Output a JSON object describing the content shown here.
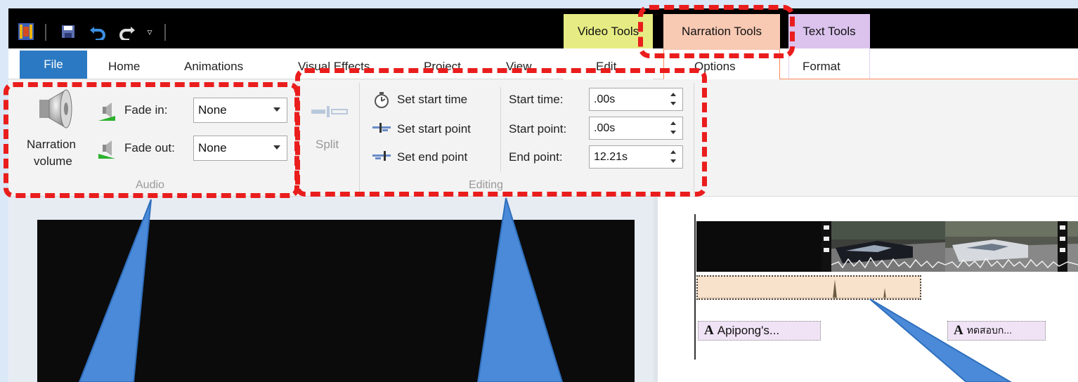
{
  "contextual_tabs": {
    "video_tools": "Video Tools",
    "narration_tools": "Narration Tools",
    "text_tools": "Text Tools"
  },
  "tabs": {
    "file": "File",
    "home": "Home",
    "animations": "Animations",
    "visual_effects": "Visual Effects",
    "project": "Project",
    "view": "View",
    "edit": "Edit",
    "options": "Options",
    "format": "Format"
  },
  "audio_group": {
    "label": "Audio",
    "narration_volume_line1": "Narration",
    "narration_volume_line2": "volume",
    "fade_in_label": "Fade in:",
    "fade_in_value": "None",
    "fade_out_label": "Fade out:",
    "fade_out_value": "None"
  },
  "split_group": {
    "label": "Split"
  },
  "editing_group": {
    "label": "Editing",
    "set_start_time": "Set start time",
    "set_start_point": "Set start point",
    "set_end_point": "Set end point",
    "start_time_label": "Start time:",
    "start_time_value": ".00s",
    "start_point_label": "Start point:",
    "start_point_value": ".00s",
    "end_point_label": "End point:",
    "end_point_value": "12.21s"
  },
  "storyboard": {
    "caption_1": "Apipong's...",
    "caption_2": "ทดสอบก..."
  },
  "colors": {
    "highlight": "#ea1d1d",
    "callout": "#4a8ad8",
    "file_tab": "#2b79c2",
    "video_tools": "#e6ec83",
    "narration_tools": "#f8c9b3",
    "text_tools": "#dcc3ee"
  }
}
